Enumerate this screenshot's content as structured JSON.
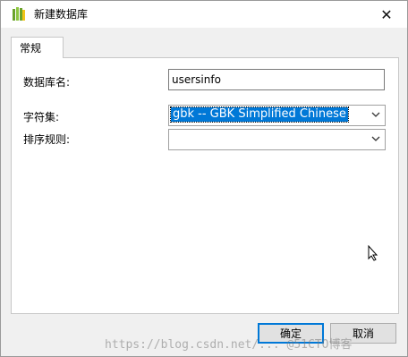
{
  "window": {
    "title": "新建数据库",
    "close_glyph": "✕"
  },
  "tabs": [
    {
      "label": "常规"
    }
  ],
  "form": {
    "db_name_label": "数据库名:",
    "db_name_value": "usersinfo",
    "charset_label": "字符集:",
    "charset_value": "gbk -- GBK Simplified Chinese",
    "collation_label": "排序规则:",
    "collation_value": ""
  },
  "buttons": {
    "ok_label": "确定",
    "cancel_label": "取消"
  },
  "watermark": "https://blog.csdn.net/... @51CTO博客",
  "colors": {
    "accent": "#0078d7",
    "panel_bg": "#ffffff",
    "dialog_bg": "#f0f0f0"
  }
}
